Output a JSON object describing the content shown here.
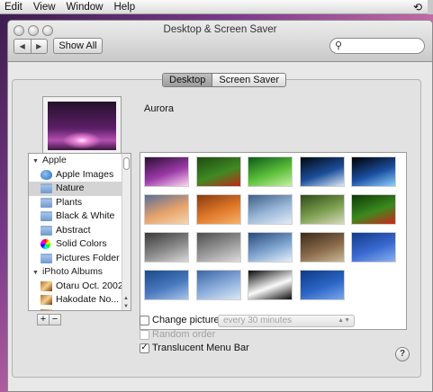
{
  "menubar": {
    "items": [
      "Edit",
      "View",
      "Window",
      "Help"
    ]
  },
  "window": {
    "title": "Desktop & Screen Saver",
    "back_label": "◀",
    "forward_label": "▶",
    "show_all_label": "Show All",
    "search_placeholder": ""
  },
  "tabs": [
    {
      "label": "Desktop",
      "selected": true
    },
    {
      "label": "Screen Saver",
      "selected": false
    }
  ],
  "current_picture": {
    "name": "Aurora"
  },
  "source_list": {
    "groups": [
      {
        "label": "Apple",
        "items": [
          {
            "label": "Apple Images",
            "icon": "apple-icon",
            "selected": false
          },
          {
            "label": "Nature",
            "icon": "folder-icon",
            "selected": true
          },
          {
            "label": "Plants",
            "icon": "folder-icon",
            "selected": false
          },
          {
            "label": "Black & White",
            "icon": "folder-icon",
            "selected": false
          },
          {
            "label": "Abstract",
            "icon": "folder-icon",
            "selected": false
          },
          {
            "label": "Solid Colors",
            "icon": "color-wheel-icon",
            "selected": false
          },
          {
            "label": "Pictures Folder",
            "icon": "folder-icon",
            "selected": false
          }
        ]
      },
      {
        "label": "iPhoto Albums",
        "items": [
          {
            "label": "Otaru Oct. 2002",
            "icon": "photo-album-icon",
            "selected": false
          },
          {
            "label": "Hakodate  No...",
            "icon": "photo-album-icon",
            "selected": false
          },
          {
            "label": "",
            "icon": "photo-album-icon",
            "selected": false
          }
        ]
      }
    ],
    "add_label": "+",
    "remove_label": "−"
  },
  "thumbnails": [
    {
      "name": "aurora",
      "colors": [
        "#2a0f34",
        "#9a3aa6",
        "#ffd6f3"
      ]
    },
    {
      "name": "ladybugs-leaf",
      "colors": [
        "#1f4a12",
        "#3f8a22",
        "#c0291a"
      ]
    },
    {
      "name": "green-drop",
      "colors": [
        "#0e5a1a",
        "#5cbf3a",
        "#c8f0a0"
      ]
    },
    {
      "name": "earth",
      "colors": [
        "#020810",
        "#1c4e9a",
        "#d9e8f5"
      ]
    },
    {
      "name": "earth-horizon",
      "colors": [
        "#000000",
        "#1a4fa0",
        "#8fd0ff"
      ]
    },
    {
      "name": "sunset-sky",
      "colors": [
        "#5a6e9a",
        "#e6a26a",
        "#f4d6b0"
      ]
    },
    {
      "name": "orange-dunes",
      "colors": [
        "#8a3a10",
        "#e0792a",
        "#f6b26a"
      ]
    },
    {
      "name": "blue-waves",
      "colors": [
        "#3d5e8a",
        "#9bb8d8",
        "#e2ecf6"
      ]
    },
    {
      "name": "zen-garden",
      "colors": [
        "#2e4a1a",
        "#7da050",
        "#d8d8c0"
      ]
    },
    {
      "name": "ladybug-grass",
      "colors": [
        "#0d3a08",
        "#3b8a1e",
        "#d0241a"
      ]
    },
    {
      "name": "foggy-lake",
      "colors": [
        "#3a3a3a",
        "#8a8a8a",
        "#d8d8d8"
      ]
    },
    {
      "name": "grey-pebbles",
      "colors": [
        "#4d4d4d",
        "#9a9a9a",
        "#dcdcdc"
      ]
    },
    {
      "name": "blue-ice",
      "colors": [
        "#2a4a7a",
        "#7fa5d0",
        "#e6f0fb"
      ]
    },
    {
      "name": "river-stones",
      "colors": [
        "#3a2a1a",
        "#8a6a4a",
        "#c9b89a"
      ]
    },
    {
      "name": "blue-water",
      "colors": [
        "#123a8a",
        "#3a6ad0",
        "#8ab0f0"
      ]
    },
    {
      "name": "calm-ocean",
      "colors": [
        "#1a4a8a",
        "#4a7abf",
        "#a8c6ea"
      ]
    },
    {
      "name": "misty-blue",
      "colors": [
        "#3a66a6",
        "#8eb0dc",
        "#dbe8f6"
      ]
    },
    {
      "name": "zebra",
      "colors": [
        "#0a0a0a",
        "#fafafa",
        "#0a0a0a"
      ]
    },
    {
      "name": "water-ripples",
      "colors": [
        "#0e3a86",
        "#2c66c6",
        "#7aa6ee"
      ]
    }
  ],
  "options": {
    "change_picture_label": "Change picture:",
    "change_picture_checked": false,
    "interval_value": "every 30 minutes",
    "random_order_label": "Random order",
    "random_order_checked": false,
    "translucent_label": "Translucent Menu Bar",
    "translucent_checked": true,
    "help_label": "?"
  }
}
